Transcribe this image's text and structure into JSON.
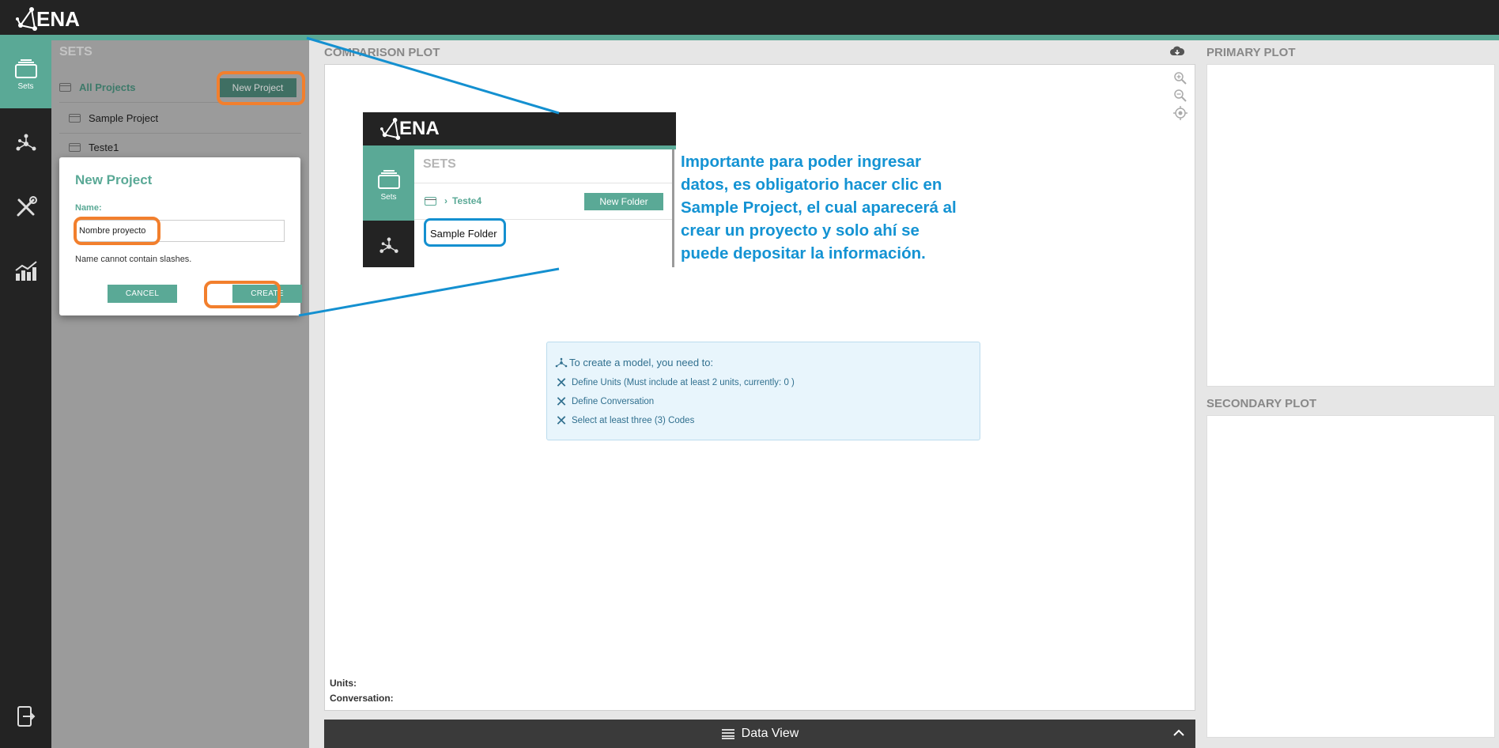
{
  "app": {
    "logo_text": "ENA"
  },
  "rail": {
    "items": [
      {
        "label": "Sets",
        "icon": "sets-icon",
        "active": true
      },
      {
        "label": "",
        "icon": "network-icon"
      },
      {
        "label": "",
        "icon": "tools-icon"
      },
      {
        "label": "",
        "icon": "chart-icon"
      },
      {
        "label": "",
        "icon": "logout-icon"
      }
    ]
  },
  "sets": {
    "title": "SETS",
    "all_projects": "All Projects",
    "new_project_label": "New Project",
    "projects": [
      "Sample Project",
      "Teste1"
    ]
  },
  "dialog": {
    "title": "New Project",
    "name_label": "Name:",
    "name_value": "Nombre proyecto",
    "hint": "Name cannot contain slashes.",
    "cancel_label": "CANCEL",
    "create_label": "CREATE"
  },
  "comparison": {
    "title": "COMPARISON PLOT",
    "units_label": "Units:",
    "conversation_label": "Conversation:"
  },
  "inset": {
    "logo_text": "ENA",
    "rail_label": "Sets",
    "sets_title": "SETS",
    "breadcrumb": "Teste4",
    "new_folder_label": "New Folder",
    "sample_folder": "Sample Folder"
  },
  "annotation": {
    "lines": [
      "Importante para poder ingresar",
      "datos, es obligatorio hacer clic en",
      "Sample Project, el cual aparecerá al",
      "crear un proyecto y solo ahí se",
      "puede depositar la información."
    ]
  },
  "model_info": {
    "title": "To create a model, you need to:",
    "items": [
      "Define Units (Must include at least 2 units, currently: 0 )",
      "Define Conversation",
      "Select at least three (3) Codes"
    ]
  },
  "data_view": {
    "label": "Data View"
  },
  "plots": {
    "primary_title": "PRIMARY PLOT",
    "secondary_title": "SECONDARY PLOT"
  },
  "colors": {
    "accent": "#5aa996",
    "topbar": "#232323",
    "highlight_orange": "#f27f2d",
    "highlight_blue": "#1490d0"
  }
}
